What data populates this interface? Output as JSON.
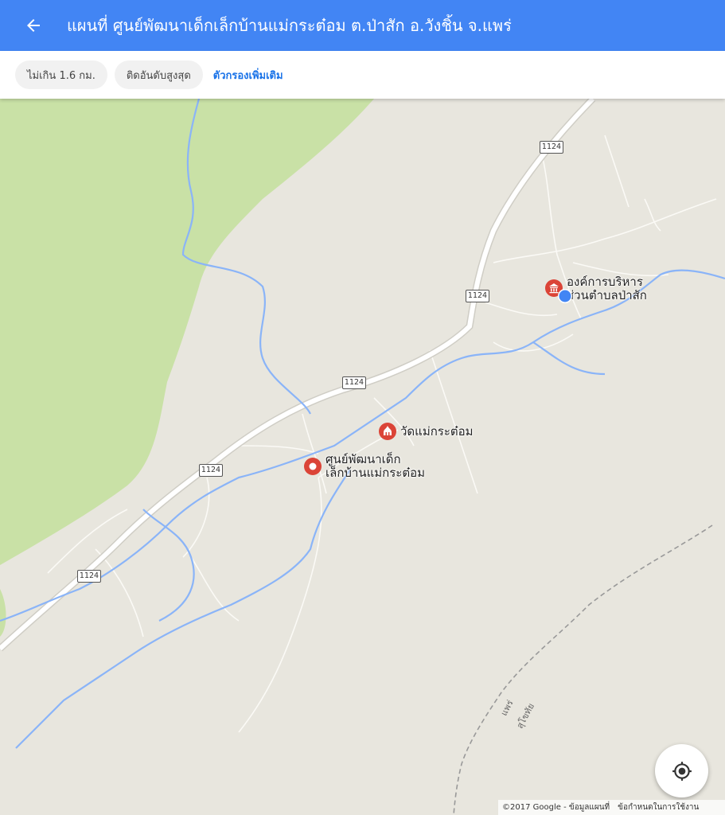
{
  "header": {
    "back_icon": "arrow-back-icon",
    "title": "แผนที่ ศูนย์พัฒนาเด็กเล็กบ้านแม่กระต๋อม ต.ป่าสัก อ.วังชิ้น จ.แพร่",
    "color": "#4285f4"
  },
  "filters": {
    "chips": [
      {
        "label": "ไม่เกิน 1.6 กม."
      },
      {
        "label": "ติดอันดับสูงสุด"
      }
    ],
    "more_label": "ตัวกรองเพิ่มเติม"
  },
  "map": {
    "route_number": "1124",
    "pois": [
      {
        "label_lines": [
          "องค์การบริหาร",
          "ส่วนตำบลป่าสัก"
        ],
        "icon": "government-building-icon",
        "color": "#db4437"
      },
      {
        "label_lines": [
          "วัดแม่กระต๋อม"
        ],
        "icon": "temple-icon",
        "color": "#db4437"
      },
      {
        "label_lines": [
          "ศูนย์พัฒนาเด็ก",
          "เล็กบ้านแม่กระต๋อม"
        ],
        "icon": "selected-place-pin-icon",
        "color": "#db4437"
      }
    ],
    "boundary_labels": [
      "แพร่",
      "สุโขทัย"
    ],
    "current_location_color": "#4285f4"
  },
  "controls": {
    "my_location_icon": "my-location-icon"
  },
  "attribution": {
    "copyright": "©2017 Google - ข้อมูลแผนที่",
    "terms": "ข้อกำหนดในการใช้งาน"
  }
}
